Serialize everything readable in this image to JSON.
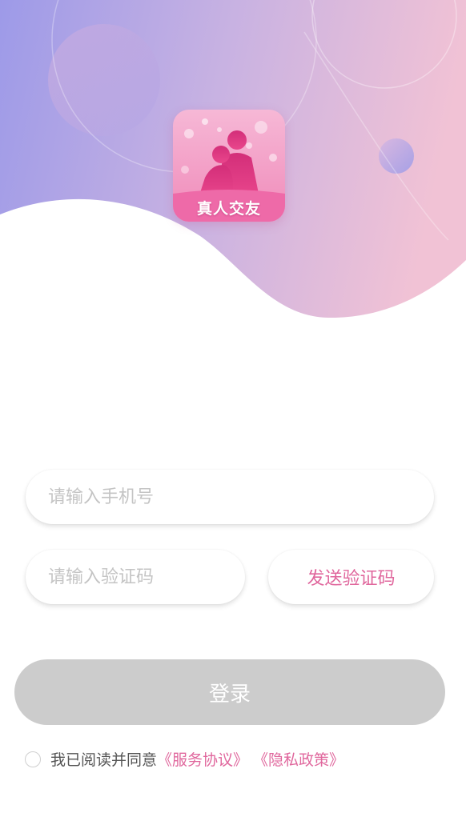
{
  "app": {
    "logo_text": "真人交友"
  },
  "form": {
    "phone_placeholder": "请输入手机号",
    "code_placeholder": "请输入验证码",
    "send_code_label": "发送验证码",
    "login_label": "登录"
  },
  "agreement": {
    "text": "我已阅读并同意",
    "service_link": "《服务协议》",
    "privacy_link": "《隐私政策》"
  },
  "colors": {
    "gradient_start": "#9a9ae8",
    "gradient_end": "#f0c0d6",
    "accent_pink": "#e0679d",
    "disabled_button": "#cccccc",
    "placeholder": "#c4c4c4"
  }
}
